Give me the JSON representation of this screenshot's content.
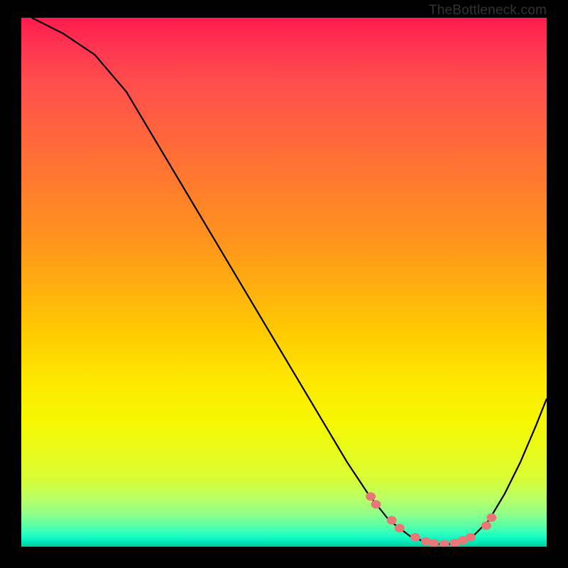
{
  "watermark": "TheBottleneck.com",
  "chart_data": {
    "type": "line",
    "title": "",
    "xlabel": "",
    "ylabel": "",
    "xlim": [
      0,
      100
    ],
    "ylim": [
      0,
      100
    ],
    "curve_points": [
      {
        "x": 2,
        "y": 100
      },
      {
        "x": 8,
        "y": 97
      },
      {
        "x": 14,
        "y": 93
      },
      {
        "x": 20,
        "y": 86
      },
      {
        "x": 26,
        "y": 76
      },
      {
        "x": 32,
        "y": 66
      },
      {
        "x": 38,
        "y": 56
      },
      {
        "x": 44,
        "y": 46
      },
      {
        "x": 50,
        "y": 36
      },
      {
        "x": 56,
        "y": 26
      },
      {
        "x": 62,
        "y": 16
      },
      {
        "x": 66,
        "y": 10
      },
      {
        "x": 70,
        "y": 5
      },
      {
        "x": 74,
        "y": 2
      },
      {
        "x": 78,
        "y": 0.5
      },
      {
        "x": 82,
        "y": 0.5
      },
      {
        "x": 86,
        "y": 2
      },
      {
        "x": 89,
        "y": 5
      },
      {
        "x": 92,
        "y": 10
      },
      {
        "x": 95,
        "y": 16
      },
      {
        "x": 98,
        "y": 23
      },
      {
        "x": 100,
        "y": 28
      }
    ],
    "marker_points": [
      {
        "x": 66.5,
        "y": 9.5
      },
      {
        "x": 67.5,
        "y": 8
      },
      {
        "x": 70.5,
        "y": 5
      },
      {
        "x": 72,
        "y": 3.5
      },
      {
        "x": 75,
        "y": 1.8
      },
      {
        "x": 77,
        "y": 1
      },
      {
        "x": 78.5,
        "y": 0.6
      },
      {
        "x": 80.5,
        "y": 0.5
      },
      {
        "x": 82.5,
        "y": 0.7
      },
      {
        "x": 84,
        "y": 1.2
      },
      {
        "x": 85.5,
        "y": 1.8
      },
      {
        "x": 88.5,
        "y": 4
      },
      {
        "x": 89.5,
        "y": 5.5
      }
    ],
    "marker_color": "#e87878",
    "curve_color": "#000000"
  }
}
